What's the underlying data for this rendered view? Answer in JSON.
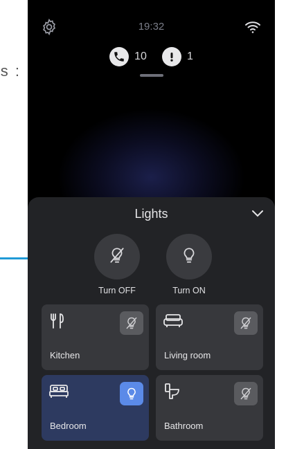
{
  "side_text": "s :",
  "status": {
    "time": "19:32"
  },
  "notifications": {
    "calls_count": "10",
    "alerts_count": "1"
  },
  "lights": {
    "title": "Lights",
    "turn_off_label": "Turn OFF",
    "turn_on_label": "Turn ON",
    "rooms": [
      {
        "label": "Kitchen",
        "state": "off"
      },
      {
        "label": "Living room",
        "state": "off"
      },
      {
        "label": "Bedroom",
        "state": "on"
      },
      {
        "label": "Bathroom",
        "state": "off"
      }
    ]
  },
  "colors": {
    "accent_line": "#1f9ad6",
    "panel_bg": "#222326",
    "tile_bg": "#37383c",
    "tile_selected_bg": "#2d3a60",
    "toggle_active": "#5b8ae8"
  },
  "icons": {
    "settings": "gear-icon",
    "wifi": "wifi-icon",
    "calls": "phone-icon",
    "alerts": "exclamation-icon",
    "collapse": "chevron-down-icon",
    "light_off": "bulb-off-icon",
    "light_on": "bulb-icon",
    "kitchen": "fork-knife-icon",
    "living_room": "sofa-icon",
    "bedroom": "bed-icon",
    "bathroom": "toilet-icon"
  }
}
